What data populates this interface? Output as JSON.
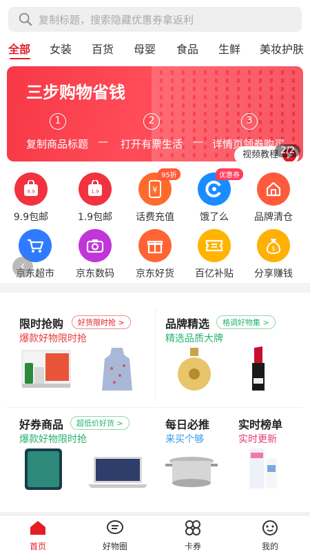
{
  "search": {
    "placeholder": "复制标题，搜索隐藏优惠券拿返利"
  },
  "tabs": [
    "全部",
    "女装",
    "百货",
    "母婴",
    "食品",
    "生鲜",
    "美妆护肤"
  ],
  "banner": {
    "title": "三步购物省钱",
    "video_label": "视频教程",
    "steps": [
      {
        "num": "1",
        "text": "复制商品标题"
      },
      {
        "num": "2",
        "text": "打开有票生活"
      },
      {
        "num": "3",
        "text": "详情页领券购买"
      }
    ],
    "dash": "—",
    "pager": "2/2"
  },
  "grid": [
    {
      "label": "9.9包邮",
      "color": "#f2323f"
    },
    {
      "label": "1.9包邮",
      "color": "#f2323f"
    },
    {
      "label": "话费充值",
      "color": "#ff6b2c",
      "badge": "95折"
    },
    {
      "label": "饿了么",
      "color": "#1a8cff",
      "badge": "优惠券"
    },
    {
      "label": "品牌清仓",
      "color": "#ff5a3c"
    },
    {
      "label": "京东超市",
      "color": "#2f7bff"
    },
    {
      "label": "京东数码",
      "color": "#c036d8"
    },
    {
      "label": "京东好货",
      "color": "#ff6534"
    },
    {
      "label": "百亿补贴",
      "color": "#ffb400"
    },
    {
      "label": "分享赚钱",
      "color": "#ffb000"
    }
  ],
  "side_toggle": "‹",
  "cards": {
    "flash": {
      "title": "限时抢购",
      "tag": "好货限时抢 >",
      "sub": "爆款好物限时抢"
    },
    "brand": {
      "title": "品牌精选",
      "tag": "格调好物集 >",
      "sub": "精选品质大牌"
    },
    "coupon": {
      "title": "好券商品",
      "tag": "超低价好货 >",
      "sub": "爆款好物限时抢"
    },
    "daily": {
      "title": "每日必推",
      "sub": "来买个够"
    },
    "rank": {
      "title": "实时榜单",
      "sub": "实时更新"
    }
  },
  "tabbar": [
    {
      "label": "首页",
      "icon": "home-icon"
    },
    {
      "label": "好物圈",
      "icon": "chat-icon"
    },
    {
      "label": "卡券",
      "icon": "clover-icon"
    },
    {
      "label": "我的",
      "icon": "face-icon"
    }
  ],
  "colors": {
    "accent": "#e61b24",
    "green": "#26b36c",
    "blue": "#3399ee",
    "pink": "#e83a74"
  }
}
